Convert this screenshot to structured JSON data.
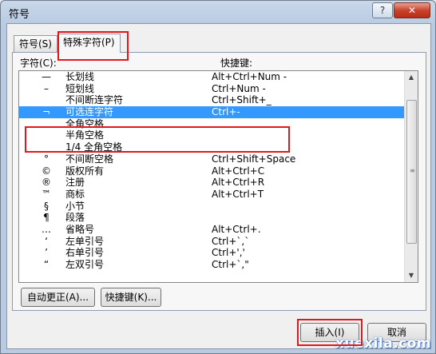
{
  "window": {
    "title": "符号",
    "help_glyph": "?",
    "close_glyph": "✕"
  },
  "tabs": [
    {
      "label": "符号(S)"
    },
    {
      "label": "特殊字符(P)"
    }
  ],
  "columns": {
    "character": "字符(C):",
    "shortcut": "快捷键:"
  },
  "rows": [
    {
      "glyph": "—",
      "name": "长划线",
      "shortcut": "Alt+Ctrl+Num -"
    },
    {
      "glyph": "–",
      "name": "短划线",
      "shortcut": "Ctrl+Num -"
    },
    {
      "glyph": "",
      "name": "不间断连字符",
      "shortcut": "Ctrl+Shift+_"
    },
    {
      "glyph": "¬",
      "name": "可选连字符",
      "shortcut": "Ctrl+-"
    },
    {
      "glyph": "",
      "name": "全角空格",
      "shortcut": ""
    },
    {
      "glyph": "",
      "name": "半角空格",
      "shortcut": ""
    },
    {
      "glyph": "",
      "name": "1/4 全角空格",
      "shortcut": ""
    },
    {
      "glyph": "°",
      "name": "不间断空格",
      "shortcut": "Ctrl+Shift+Space"
    },
    {
      "glyph": "©",
      "name": "版权所有",
      "shortcut": "Alt+Ctrl+C"
    },
    {
      "glyph": "®",
      "name": "注册",
      "shortcut": "Alt+Ctrl+R"
    },
    {
      "glyph": "™",
      "name": "商标",
      "shortcut": "Alt+Ctrl+T"
    },
    {
      "glyph": "§",
      "name": "小节",
      "shortcut": ""
    },
    {
      "glyph": "¶",
      "name": "段落",
      "shortcut": ""
    },
    {
      "glyph": "…",
      "name": "省略号",
      "shortcut": "Alt+Ctrl+."
    },
    {
      "glyph": "‘",
      "name": "左单引号",
      "shortcut": "Ctrl+`,`"
    },
    {
      "glyph": "’",
      "name": "右单引号",
      "shortcut": "Ctrl+','"
    },
    {
      "glyph": "“",
      "name": "左双引号",
      "shortcut": "Ctrl+`,\""
    }
  ],
  "selected_row": 3,
  "buttons": {
    "autocorrect": "自动更正(A)...",
    "shortcut_key": "快捷键(K)...",
    "insert": "插入(I)",
    "cancel": "取消"
  },
  "watermark": "xuexila.com",
  "colors": {
    "selection": "#3399ff",
    "annotation": "#e0181b"
  }
}
